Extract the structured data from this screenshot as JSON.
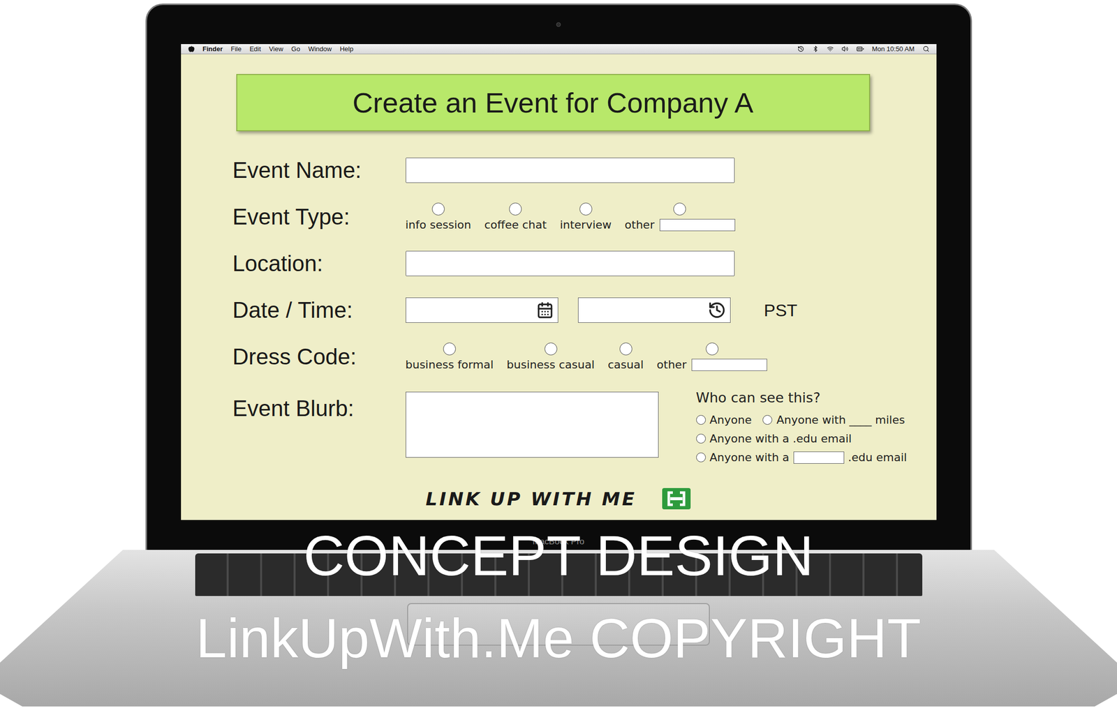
{
  "menu_bar": {
    "items": [
      {
        "label": "Finder",
        "bold": true
      },
      {
        "label": "File",
        "bold": false
      },
      {
        "label": "Edit",
        "bold": false
      },
      {
        "label": "View",
        "bold": false
      },
      {
        "label": "Go",
        "bold": false
      },
      {
        "label": "Window",
        "bold": false
      },
      {
        "label": "Help",
        "bold": false
      }
    ],
    "clock": "Mon 10:50 AM"
  },
  "device_label": "MacBook Pro",
  "form": {
    "title": "Create an Event for Company A",
    "fields": [
      {
        "label": "Event Name:",
        "kind": "text"
      },
      {
        "label": "Event Type:",
        "kind": "radio",
        "options": [
          {
            "label": "info session",
            "selected": false,
            "kind": "plain"
          },
          {
            "label": "coffee chat",
            "selected": false,
            "kind": "plain"
          },
          {
            "label": "interview",
            "selected": false,
            "kind": "plain"
          },
          {
            "label": "other",
            "selected": false,
            "kind": "other"
          }
        ]
      },
      {
        "label": "Location:",
        "kind": "text"
      },
      {
        "label": "Date / Time:",
        "kind": "datetime",
        "zone": "PST"
      },
      {
        "label": "Dress Code:",
        "kind": "radio",
        "options": [
          {
            "label": "business formal",
            "selected": false,
            "kind": "plain"
          },
          {
            "label": "business casual",
            "selected": false,
            "kind": "plain"
          },
          {
            "label": "casual",
            "selected": false,
            "kind": "plain"
          },
          {
            "label": "other",
            "selected": false,
            "kind": "other"
          }
        ]
      },
      {
        "label": "Event Blurb:",
        "kind": "textarea"
      }
    ],
    "visibility": {
      "heading": "Who can see this?",
      "rows": [
        [
          {
            "kind": "plain",
            "label": "Anyone",
            "selected": false
          },
          {
            "kind": "plain",
            "label": "Anyone with ____ miles",
            "selected": false
          }
        ],
        [
          {
            "kind": "plain",
            "label": "Anyone with a .edu email",
            "selected": false
          }
        ],
        [
          {
            "kind": "field",
            "before": "Anyone with a",
            "after": ".edu email",
            "selected": false
          }
        ]
      ]
    },
    "brand": "LINK UP WITH ME"
  },
  "watermark": [
    "CONCEPT DESIGN",
    "LinkUpWith.Me COPYRIGHT"
  ]
}
